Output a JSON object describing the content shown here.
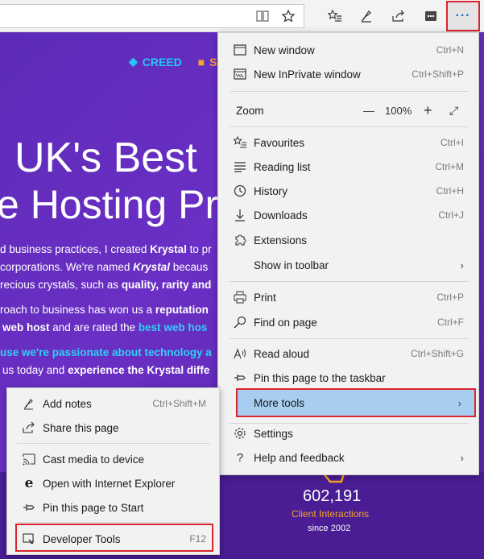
{
  "toolbar": {
    "icons": [
      "reading-view-icon",
      "favorite-star-icon",
      "favorites-hub-icon",
      "add-notes-icon",
      "share-icon",
      "extension-icon",
      "more-icon"
    ],
    "more_label": "···"
  },
  "page": {
    "brand1": "CREED",
    "brand2": "S",
    "hero_line1": "UK's Best",
    "hero_line2": "e Hosting Pr",
    "p1a": "d business practices, I created ",
    "p1b": "Krystal",
    "p1c": " to pr",
    "p2a": "corporations. We're named ",
    "p2b": "Krystal",
    "p2c": " becaus",
    "p3a": "recious crystals, such as ",
    "p3b": "quality, rarity and",
    "p4a": "roach to business has won us a ",
    "p4b": "reputation",
    "p5a": "web host",
    "p5b": " and are rated the ",
    "p5c": "best web hos",
    "p6": "use we're passionate about technology a",
    "p7a": "us today and ",
    "p7b": "experience the Krystal diffe",
    "count": "602,191",
    "count_label": "Client Interactions",
    "since": "since 2002"
  },
  "menu": {
    "new_window": {
      "label": "New window",
      "shortcut": "Ctrl+N"
    },
    "inprivate": {
      "label": "New InPrivate window",
      "shortcut": "Ctrl+Shift+P"
    },
    "zoom": {
      "label": "Zoom",
      "minus": "—",
      "value": "100%",
      "plus": "+",
      "fullscreen": "⤢"
    },
    "favourites": {
      "label": "Favourites",
      "shortcut": "Ctrl+I"
    },
    "reading_list": {
      "label": "Reading list",
      "shortcut": "Ctrl+M"
    },
    "history": {
      "label": "History",
      "shortcut": "Ctrl+H"
    },
    "downloads": {
      "label": "Downloads",
      "shortcut": "Ctrl+J"
    },
    "extensions": {
      "label": "Extensions"
    },
    "show_toolbar": {
      "label": "Show in toolbar",
      "chevron": "›"
    },
    "print": {
      "label": "Print",
      "shortcut": "Ctrl+P"
    },
    "find": {
      "label": "Find on page",
      "shortcut": "Ctrl+F"
    },
    "read_aloud": {
      "label": "Read aloud",
      "shortcut": "Ctrl+Shift+G"
    },
    "pin_taskbar": {
      "label": "Pin this page to the taskbar"
    },
    "more_tools": {
      "label": "More tools",
      "chevron": "›"
    },
    "settings": {
      "label": "Settings"
    },
    "help": {
      "label": "Help and feedback",
      "chevron": "›"
    }
  },
  "submenu": {
    "add_notes": {
      "label": "Add notes",
      "shortcut": "Ctrl+Shift+M"
    },
    "share": {
      "label": "Share this page"
    },
    "cast": {
      "label": "Cast media to device"
    },
    "open_ie": {
      "label": "Open with Internet Explorer"
    },
    "pin_start": {
      "label": "Pin this page to Start"
    },
    "dev_tools": {
      "label": "Developer Tools",
      "shortcut": "F12"
    }
  },
  "colors": {
    "accent_red": "#d9252b",
    "highlight": "#a7cdf0",
    "page_purple": "#5d2bb8",
    "cyan": "#2fd0f5",
    "orange": "#f6a623"
  }
}
